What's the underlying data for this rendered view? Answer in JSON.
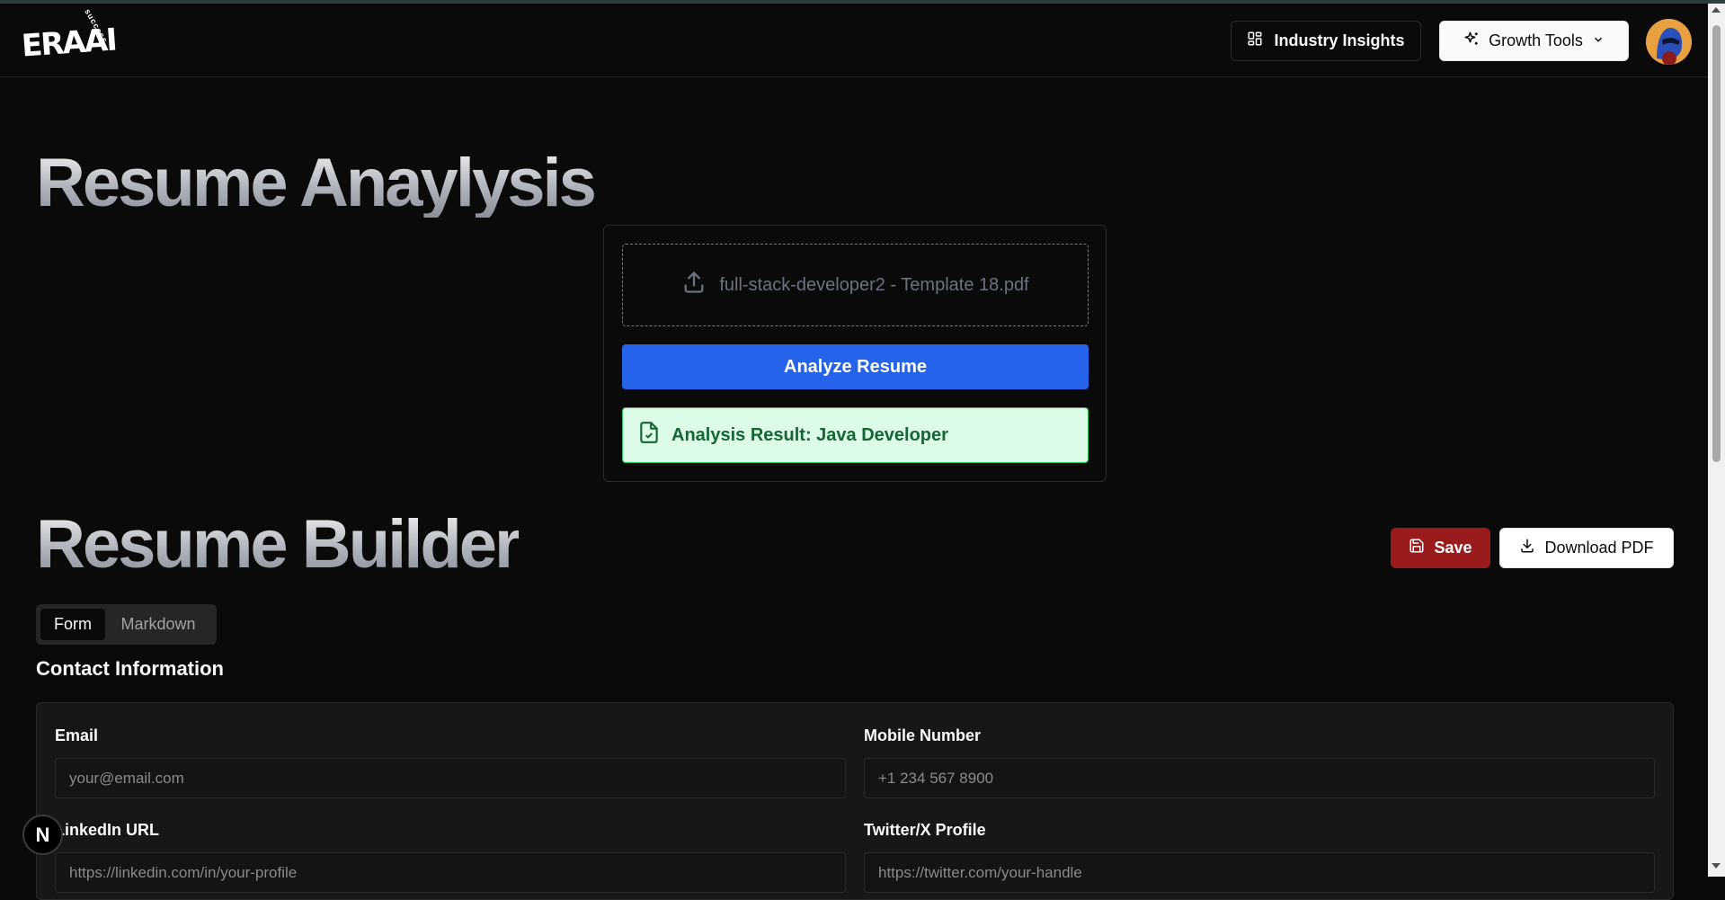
{
  "header": {
    "logo_text": "ERAAI",
    "logo_subtext": "success",
    "insights_label": "Industry Insights",
    "growth_label": "Growth Tools"
  },
  "analysis": {
    "title": "Resume Anaylysis",
    "file_name": "full-stack-developer2 - Template 18.pdf",
    "analyze_label": "Analyze Resume",
    "result_text": "Analysis Result: Java Developer"
  },
  "builder": {
    "title": "Resume Builder",
    "save_label": "Save",
    "download_label": "Download PDF",
    "tabs": [
      {
        "label": "Form",
        "active": true
      },
      {
        "label": "Markdown",
        "active": false
      }
    ],
    "section_title": "Contact Information",
    "fields": {
      "email": {
        "label": "Email",
        "placeholder": "your@email.com",
        "value": ""
      },
      "mobile": {
        "label": "Mobile Number",
        "placeholder": "+1 234 567 8900",
        "value": ""
      },
      "linkedin": {
        "label": "LinkedIn URL",
        "placeholder": "https://linkedin.com/in/your-profile",
        "value": ""
      },
      "twitter": {
        "label": "Twitter/X Profile",
        "placeholder": "https://twitter.com/your-handle",
        "value": ""
      }
    }
  },
  "dev_badge": "N",
  "colors": {
    "primary_blue": "#2563eb",
    "save_red": "#991b1b",
    "result_green_bg": "#dcfce7",
    "result_green_text": "#166534"
  }
}
